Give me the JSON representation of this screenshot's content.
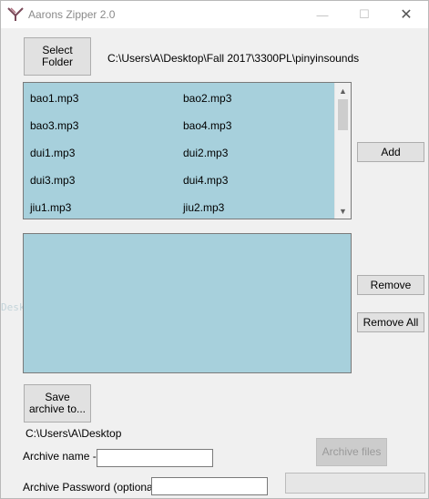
{
  "window": {
    "title": "Aarons Zipper 2.0",
    "controls": {
      "minimize": "—",
      "maximize": "☐",
      "close": "✕"
    }
  },
  "select_folder_label": "Select\nFolder",
  "folder_path": "C:\\Users\\A\\Desktop\\Fall 2017\\3300PL\\pinyinsounds",
  "file_list": {
    "rows": [
      [
        "bao1.mp3",
        "bao2.mp3"
      ],
      [
        "bao3.mp3",
        "bao4.mp3"
      ],
      [
        "dui1.mp3",
        "dui2.mp3"
      ],
      [
        "dui3.mp3",
        "dui4.mp3"
      ],
      [
        "jiu1.mp3",
        "jiu2.mp3"
      ]
    ]
  },
  "buttons": {
    "add": "Add",
    "remove": "Remove",
    "remove_all": "Remove All",
    "save_archive": "Save\narchive to...",
    "archive_files": "Archive files"
  },
  "save_path": "C:\\Users\\A\\Desktop",
  "archive_name_label": "Archive name -",
  "archive_name_value": "",
  "archive_password_label": "Archive Password (optional) -",
  "archive_password_value": "",
  "background_ghost_text": "Desktop));",
  "colors": {
    "listbox": "#a7d0dc",
    "window": "#f0f0f0"
  }
}
